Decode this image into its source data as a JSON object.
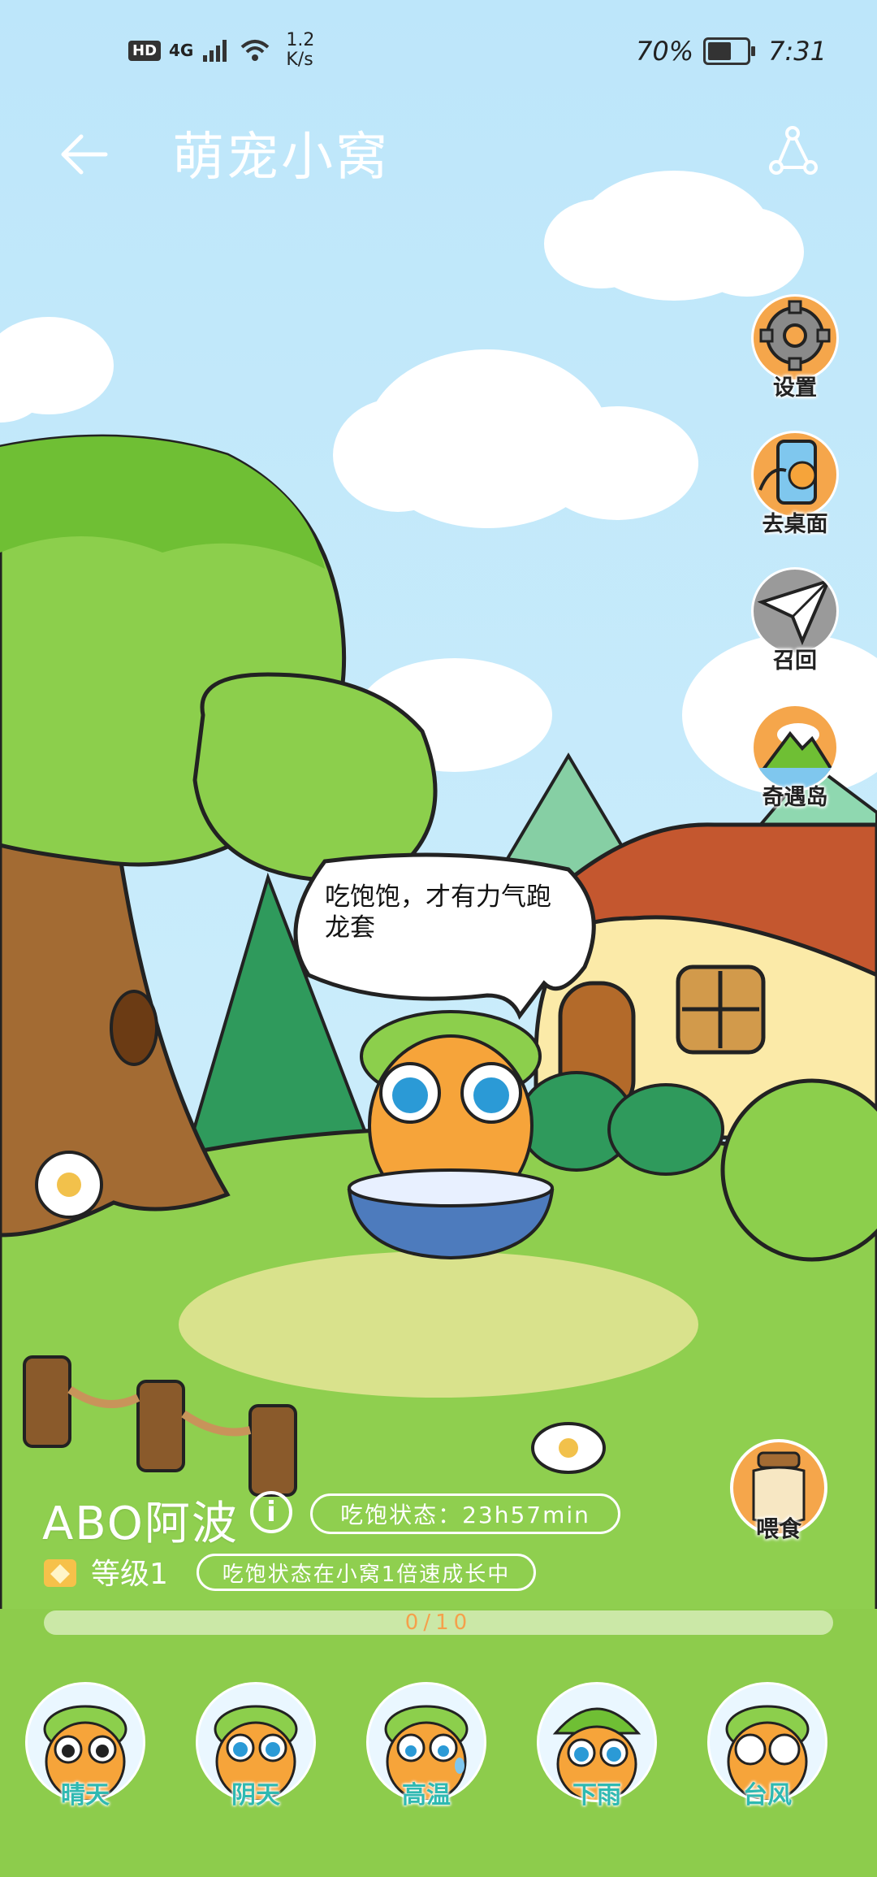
{
  "status_bar": {
    "hd": "HD",
    "network": "4G",
    "speed_value": "1.2",
    "speed_unit": "K/s",
    "battery_percent": "70%",
    "battery_level": 0.7,
    "time": "7:31"
  },
  "header": {
    "back_icon": "back-arrow-icon",
    "title": "萌宠小窝",
    "share_icon": "share-icon"
  },
  "side_menu": [
    {
      "label": "设置",
      "icon": "gear-icon"
    },
    {
      "label": "去桌面",
      "icon": "phone-desktop-icon"
    },
    {
      "label": "召回",
      "icon": "paper-plane-icon"
    },
    {
      "label": "奇遇岛",
      "icon": "island-icon"
    }
  ],
  "speech_bubble": {
    "text": "吃饱饱，才有力气跑龙套"
  },
  "pet": {
    "name": "ABO阿波",
    "full_status": "吃饱状态：23h57min",
    "level": "等级1",
    "growth_note": "吃饱状态在小窝1倍速成长中",
    "progress_text": "0/10",
    "progress_value": 0,
    "progress_max": 10
  },
  "feed": {
    "label": "喂食",
    "icon": "food-jar-icon"
  },
  "weather_options": [
    {
      "label": "晴天",
      "icon": "sunny-pet-icon"
    },
    {
      "label": "阴天",
      "icon": "cloudy-pet-icon"
    },
    {
      "label": "高温",
      "icon": "hot-pet-icon"
    },
    {
      "label": "下雨",
      "icon": "rain-pet-icon"
    },
    {
      "label": "台风",
      "icon": "typhoon-pet-icon"
    }
  ],
  "colors": {
    "sky": "#c9ecfb",
    "grass": "#8fcf4f",
    "tree": "#8ccf4c",
    "weather_label": "#2fb9b2",
    "progress_text": "#f5a04b"
  }
}
